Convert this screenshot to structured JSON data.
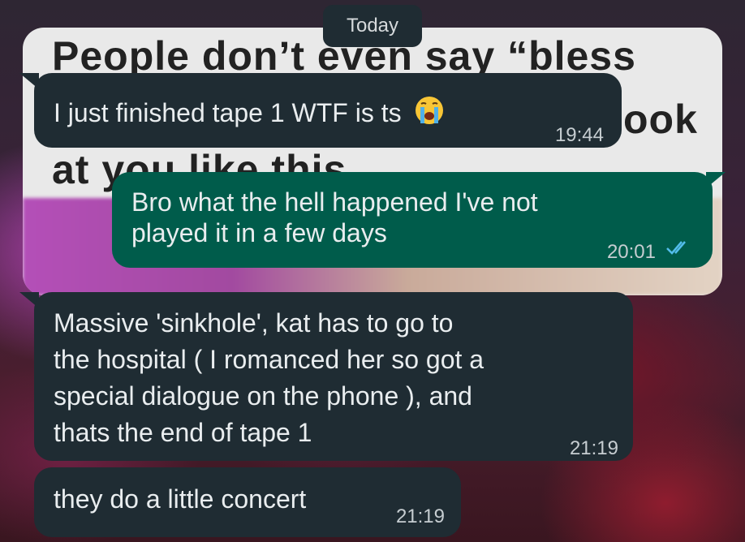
{
  "background_meme": {
    "line1": "People don’t even say “bless",
    "line2": "ook",
    "line3": "at you like this"
  },
  "date_label": "Today",
  "messages": [
    {
      "direction": "incoming",
      "text": "I just finished tape 1 WTF is ts",
      "emoji": "loudly-crying-face-icon",
      "time": "19:44"
    },
    {
      "direction": "outgoing",
      "lines": [
        "Bro what the hell happened I've not",
        "played it in a few days"
      ],
      "time": "20:01",
      "status": "read"
    },
    {
      "direction": "incoming",
      "lines": [
        "Massive 'sinkhole', kat has to go to",
        "the hospital ( I romanced her so got a",
        "special dialogue on the phone ), and",
        "thats the end of tape 1"
      ],
      "time": "21:19"
    },
    {
      "direction": "incoming",
      "text": "they do a little concert",
      "time": "21:19"
    }
  ],
  "colors": {
    "incoming_bubble": "#1f2c33",
    "outgoing_bubble": "#005c4b",
    "read_ticks": "#53bdeb"
  }
}
